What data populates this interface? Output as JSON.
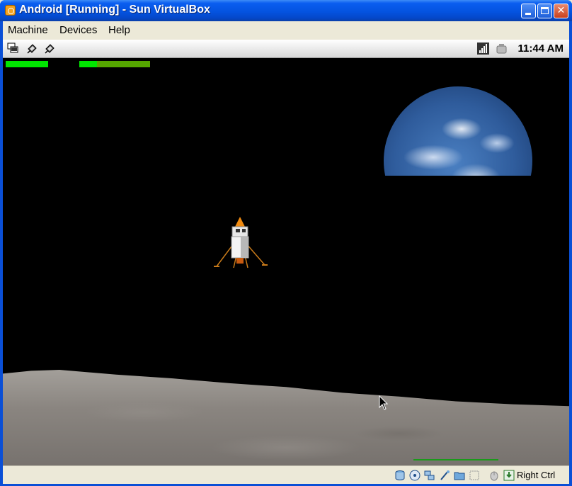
{
  "window": {
    "title": "Android [Running] - Sun VirtualBox"
  },
  "menu": {
    "items": [
      "Machine",
      "Devices",
      "Help"
    ]
  },
  "android_status": {
    "time": "11:44 AM"
  },
  "game": {
    "fuel_level": 1.0,
    "speed_level": 0.25
  },
  "host": {
    "key_label": "Right Ctrl"
  },
  "colors": {
    "titlebar": "#0453e0",
    "gauge": "#00e600",
    "screen": "#000000"
  }
}
